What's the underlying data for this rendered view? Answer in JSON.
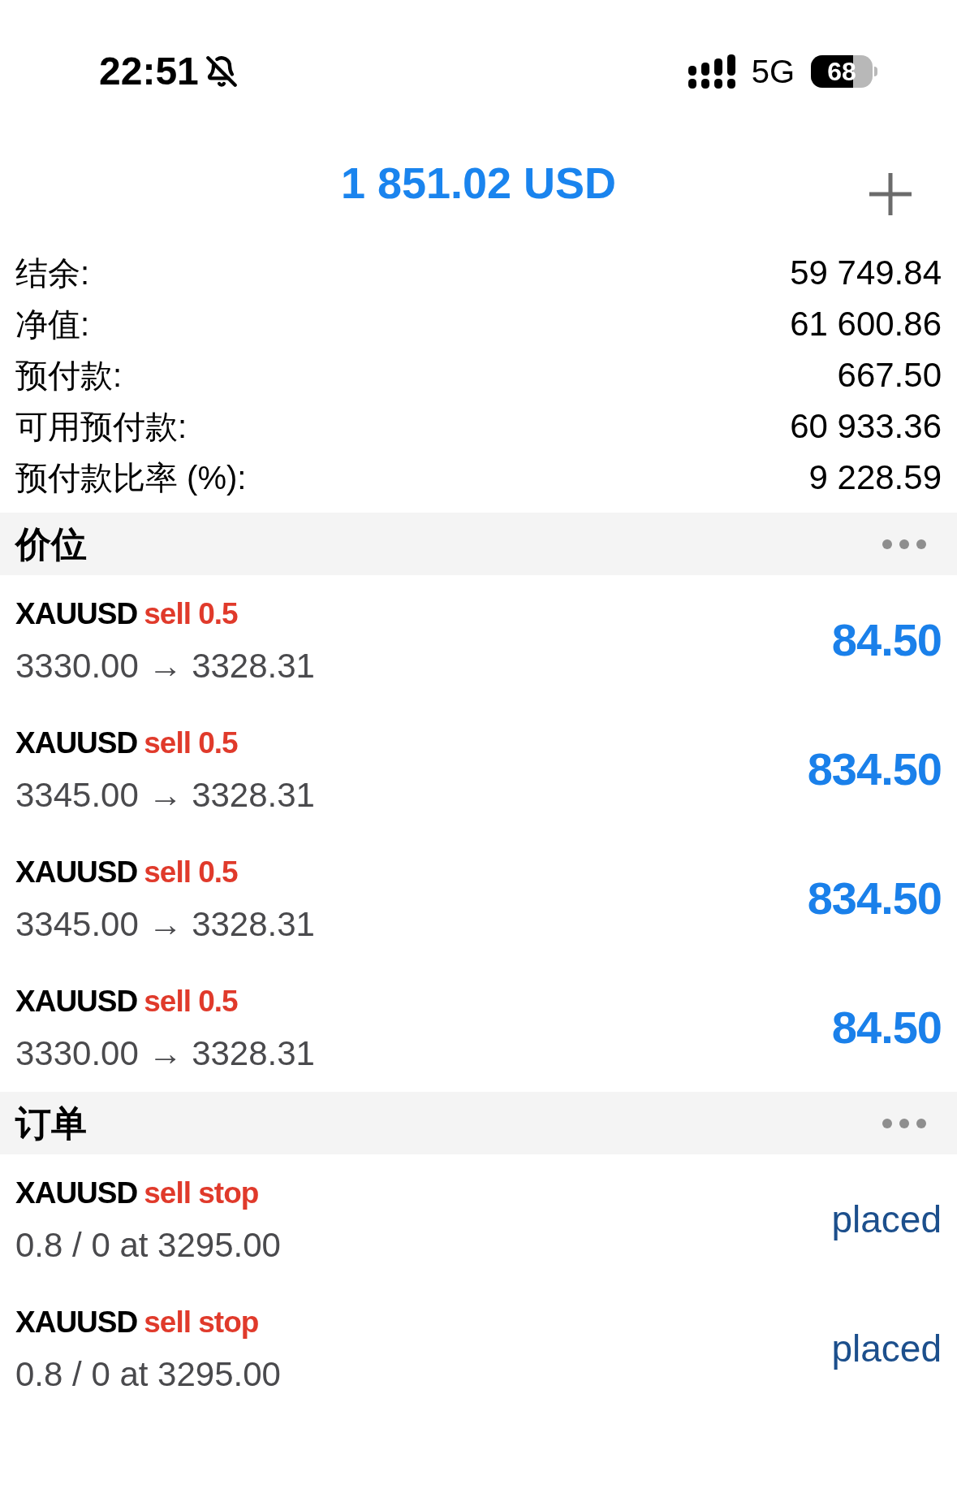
{
  "status_bar": {
    "time": "22:51",
    "network": "5G",
    "battery": "68"
  },
  "header": {
    "title": "1 851.02 USD"
  },
  "account": [
    {
      "label": "结余:",
      "value": "59 749.84"
    },
    {
      "label": "净值:",
      "value": "61 600.86"
    },
    {
      "label": "预付款:",
      "value": "667.50"
    },
    {
      "label": "可用预付款:",
      "value": "60 933.36"
    },
    {
      "label": "预付款比率 (%):",
      "value": "9 228.59"
    }
  ],
  "sections": [
    {
      "kind": "positions",
      "title": "价位",
      "items": [
        {
          "symbol": "XAUUSD",
          "side": "sell 0.5",
          "detail": "3330.00 → 3328.31",
          "value": "84.50"
        },
        {
          "symbol": "XAUUSD",
          "side": "sell 0.5",
          "detail": "3345.00 → 3328.31",
          "value": "834.50"
        },
        {
          "symbol": "XAUUSD",
          "side": "sell 0.5",
          "detail": "3345.00 → 3328.31",
          "value": "834.50"
        },
        {
          "symbol": "XAUUSD",
          "side": "sell 0.5",
          "detail": "3330.00 → 3328.31",
          "value": "84.50"
        }
      ]
    },
    {
      "kind": "orders",
      "title": "订单",
      "items": [
        {
          "symbol": "XAUUSD",
          "side": "sell stop",
          "detail": "0.8 / 0 at 3295.00",
          "value": "placed"
        },
        {
          "symbol": "XAUUSD",
          "side": "sell stop",
          "detail": "0.8 / 0 at 3295.00",
          "value": "placed"
        }
      ]
    }
  ]
}
